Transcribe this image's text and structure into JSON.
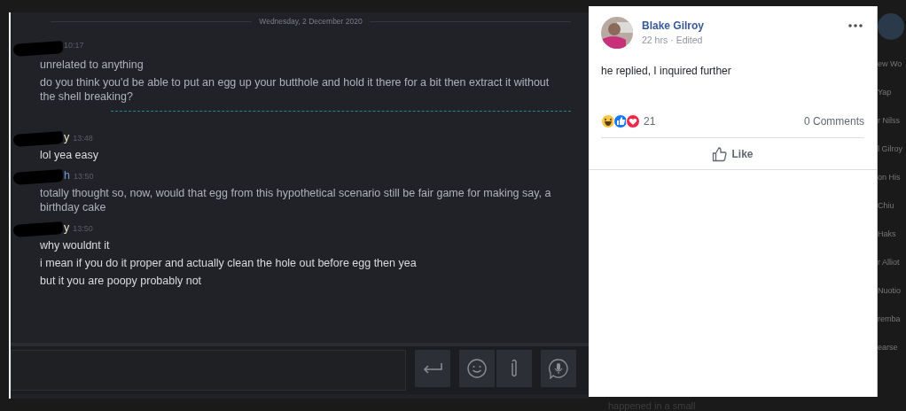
{
  "chat": {
    "date": "Wednesday, 2 December 2020",
    "messages": [
      {
        "kind": "self",
        "time": "10:17",
        "lines": [
          "unrelated to anything",
          "do you think you'd be able to put an egg up your butthole and hold it there for a bit then extract it without the shell breaking?"
        ]
      },
      {
        "kind": "unread_divider"
      },
      {
        "kind": "friend",
        "name": "y",
        "time": "13:48",
        "lines": [
          "lol yea easy"
        ]
      },
      {
        "kind": "self",
        "name": "h",
        "time": "13:50",
        "lines": [
          "totally thought so, now, would that egg from this hypothetical scenario still be fair game for making say, a birthday cake"
        ]
      },
      {
        "kind": "friend",
        "name": "y",
        "time": "13:50",
        "lines": [
          "why wouldnt it",
          "i mean if you do it proper and actually clean the hole out before egg then yea",
          "but it you are poopy probably not"
        ]
      }
    ]
  },
  "post": {
    "author": "Blake Gilroy",
    "age": "22 hrs",
    "separator": "·",
    "edited": "Edited",
    "text": "he replied, I inquired further",
    "reaction_count": "21",
    "comments": "0 Comments",
    "like_label": "Like"
  },
  "background": {
    "side_names": [
      "ew Wo",
      "Yap",
      "r Nilss",
      "l Gilroy",
      "on His",
      "Chiu",
      "Haks",
      "r Alliot",
      "Nuotio",
      "remba",
      "earse"
    ],
    "bottom_text": "happened in a small"
  }
}
